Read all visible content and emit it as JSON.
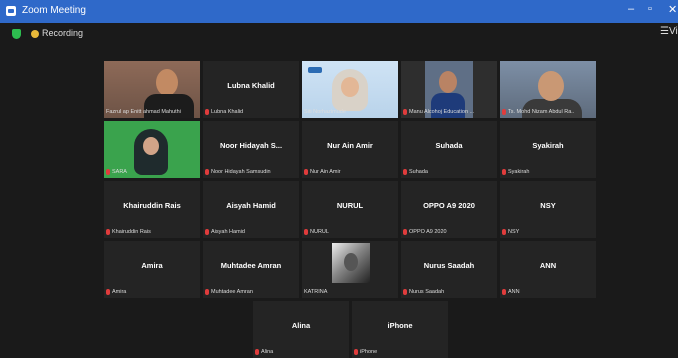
{
  "window": {
    "title": "Zoom Meeting",
    "controls": {
      "minimize": "–",
      "maximize": "▫",
      "close": "✕"
    }
  },
  "toolbar": {
    "recording_label": "Recording",
    "view_label": "Vi",
    "view_glyph": "☰"
  },
  "colors": {
    "titlebar": "#2f69c9",
    "background": "#1a1a1a",
    "tile": "#242424",
    "active_speaker": "#c8e02a",
    "muted_icon": "#e03c3c"
  },
  "participants": [
    {
      "name": "",
      "caption": "Fazrul ap Enitt ahmad Mahuthi",
      "muted": false,
      "video": "man-glasses",
      "active": false
    },
    {
      "name": "Lubna Khalid",
      "caption": "Lubna Khalid",
      "muted": true,
      "video": null,
      "active": false
    },
    {
      "name": "",
      "caption": "Siti Norhazimude",
      "muted": false,
      "video": "woman-hijab-slide",
      "active": true
    },
    {
      "name": "",
      "caption": "Manu Alcohoj Education ...",
      "muted": true,
      "video": "woman-hijab-dark",
      "active": false
    },
    {
      "name": "",
      "caption": "Ts. Mohd Nizam Abdul Ra..",
      "muted": true,
      "video": "man-cap",
      "active": false
    },
    {
      "name": "",
      "caption": "SARA",
      "muted": true,
      "video": "woman-green-screen",
      "active": false
    },
    {
      "name": "Noor Hidayah S...",
      "caption": "Noor Hidayah Samsudin",
      "muted": true,
      "video": null,
      "active": false
    },
    {
      "name": "Nur Ain Amir",
      "caption": "Nur Ain Amir",
      "muted": true,
      "video": null,
      "active": false
    },
    {
      "name": "Suhada",
      "caption": "Suhada",
      "muted": true,
      "video": null,
      "active": false
    },
    {
      "name": "Syakirah",
      "caption": "Syakirah",
      "muted": true,
      "video": null,
      "active": false
    },
    {
      "name": "Khairuddin Rais",
      "caption": "Khairuddin Rais",
      "muted": true,
      "video": null,
      "active": false
    },
    {
      "name": "Aisyah Hamid",
      "caption": "Aisyah Hamid",
      "muted": true,
      "video": null,
      "active": false
    },
    {
      "name": "NURUL",
      "caption": "NURUL",
      "muted": true,
      "video": null,
      "active": false
    },
    {
      "name": "OPPO A9 2020",
      "caption": "OPPO A9 2020",
      "muted": true,
      "video": null,
      "active": false
    },
    {
      "name": "NSY",
      "caption": "NSY",
      "muted": true,
      "video": null,
      "active": false
    },
    {
      "name": "Amira",
      "caption": "Amira",
      "muted": true,
      "video": null,
      "active": false
    },
    {
      "name": "Muhtadee Amran",
      "caption": "Muhtadee Amran",
      "muted": true,
      "video": null,
      "active": false
    },
    {
      "name": "",
      "caption": "KATRINA",
      "muted": false,
      "video": "profile-photo",
      "active": false
    },
    {
      "name": "Nurus Saadah",
      "caption": "Nurus Saadah",
      "muted": true,
      "video": null,
      "active": false
    },
    {
      "name": "ANN",
      "caption": "ANN",
      "muted": true,
      "video": null,
      "active": false
    },
    {
      "name": "Alina",
      "caption": "Alina",
      "muted": true,
      "video": null,
      "active": false
    },
    {
      "name": "iPhone",
      "caption": "iPhone",
      "muted": true,
      "video": null,
      "active": false
    }
  ]
}
